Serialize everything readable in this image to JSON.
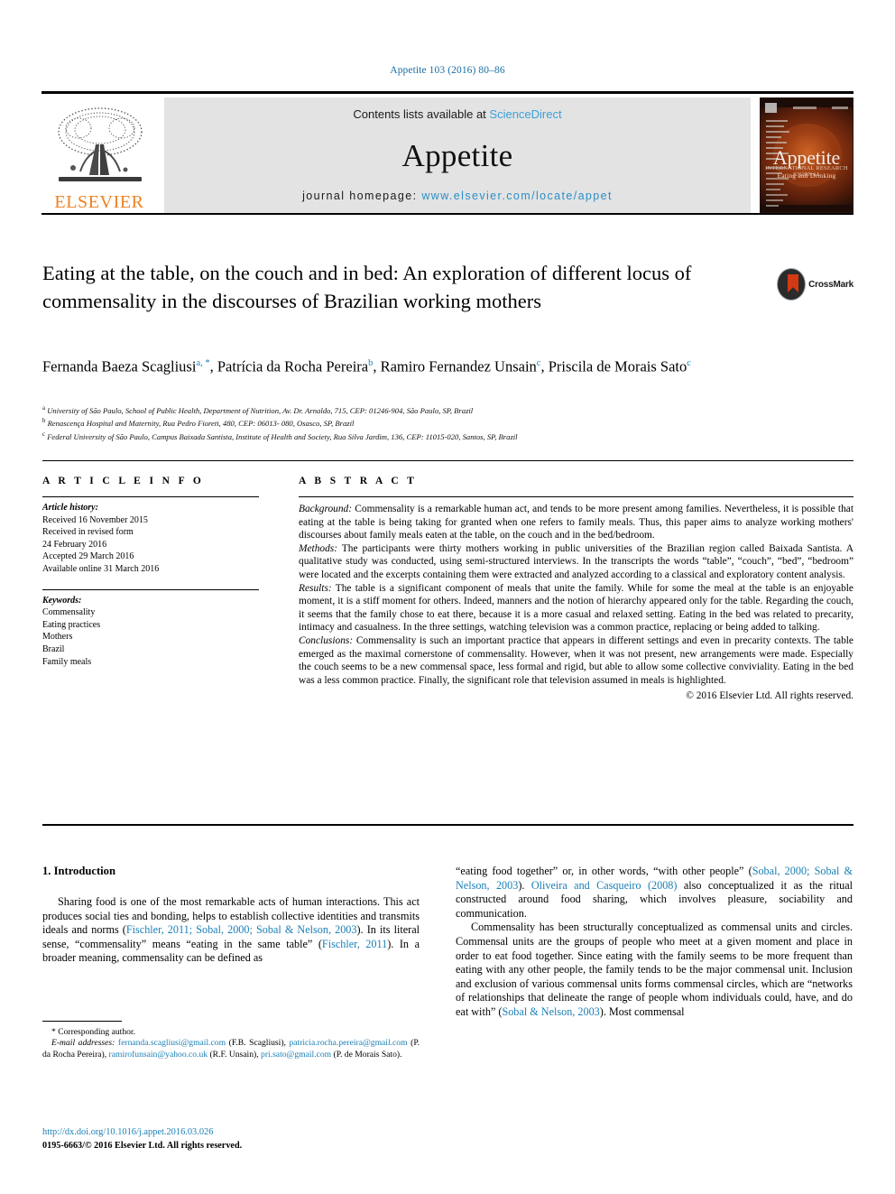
{
  "running_head": "Appetite 103 (2016) 80–86",
  "masthead": {
    "publisher_wordmark": "ELSEVIER",
    "contents_prefix": "Contents lists available at ",
    "contents_link": "ScienceDirect",
    "journal_name": "Appetite",
    "homepage_prefix": "journal homepage: ",
    "homepage_url": "www.elsevier.com/locate/appet",
    "cover_title": "Appetite",
    "cover_subtitle_small": "INTERNATIONAL RESEARCH JOURNAL",
    "cover_subtitle": "Eating and Drinking"
  },
  "crossmark": {
    "label": "CrossMark"
  },
  "article": {
    "title": "Eating at the table, on the couch and in bed: An exploration of different locus of commensality in the discourses of Brazilian working mothers",
    "authors_line_1": "Fernanda Baeza Scagliusi",
    "authors_line_1_sup": "a, *",
    "author_2": "Patrícia da Rocha Pereira",
    "author_2_sup": "b",
    "author_3": "Ramiro Fernandez Unsain",
    "author_3_sup": "c",
    "author_4": "Priscila de Morais Sato",
    "author_4_sup": "c",
    "affiliations": [
      {
        "marker": "a",
        "text": "University of São Paulo, School of Public Health, Department of Nutrition, Av. Dr. Arnaldo, 715, CEP: 01246-904, São Paulo, SP, Brazil"
      },
      {
        "marker": "b",
        "text": "Renascença Hospital and Maternity, Rua Pedro Fioreti, 480, CEP: 06013- 080, Osasco, SP, Brazil"
      },
      {
        "marker": "c",
        "text": "Federal University of São Paulo, Campus Baixada Santista, Institute of Health and Society, Rua Silva Jardim, 136, CEP: 11015-020, Santos, SP, Brazil"
      }
    ]
  },
  "article_info": {
    "heading": "A R T I C L E   I N F O",
    "history_label": "Article history:",
    "history": [
      "Received 16 November 2015",
      "Received in revised form",
      "24 February 2016",
      "Accepted 29 March 2016",
      "Available online 31 March 2016"
    ],
    "keywords_label": "Keywords:",
    "keywords": [
      "Commensality",
      "Eating practices",
      "Mothers",
      "Brazil",
      "Family meals"
    ]
  },
  "abstract": {
    "heading": "A B S T R A C T",
    "sections": [
      {
        "label": "Background:",
        "text": " Commensality is a remarkable human act, and tends to be more present among families. Nevertheless, it is possible that eating at the table is being taking for granted when one refers to family meals. Thus, this paper aims to analyze working mothers' discourses about family meals eaten at the table, on the couch and in the bed/bedroom."
      },
      {
        "label": "Methods:",
        "text": " The participants were thirty mothers working in public universities of the Brazilian region called Baixada Santista. A qualitative study was conducted, using semi-structured interviews. In the transcripts the words “table”, “couch”, “bed”, “bedroom” were located and the excerpts containing them were extracted and analyzed according to a classical and exploratory content analysis."
      },
      {
        "label": "Results:",
        "text": " The table is a significant component of meals that unite the family. While for some the meal at the table is an enjoyable moment, it is a stiff moment for others. Indeed, manners and the notion of hierarchy appeared only for the table. Regarding the couch, it seems that the family chose to eat there, because it is a more casual and relaxed setting. Eating in the bed was related to precarity, intimacy and casualness. In the three settings, watching television was a common practice, replacing or being added to talking."
      },
      {
        "label": "Conclusions:",
        "text": " Commensality is such an important practice that appears in different settings and even in precarity contexts. The table emerged as the maximal cornerstone of commensality. However, when it was not present, new arrangements were made. Especially the couch seems to be a new commensal space, less formal and rigid, but able to allow some collective conviviality. Eating in the bed was a less common practice. Finally, the significant role that television assumed in meals is highlighted."
      }
    ],
    "copyright": "© 2016 Elsevier Ltd. All rights reserved."
  },
  "introduction": {
    "heading": "1. Introduction",
    "left_paragraph_1_a": "Sharing food is one of the most remarkable acts of human interactions. This act produces social ties and bonding, helps to establish collective identities and transmits ideals and norms (",
    "left_cite_1": "Fischler, 2011; Sobal, 2000; Sobal & Nelson, 2003",
    "left_paragraph_1_b": "). In its literal sense, “commensality” means “eating in the same table” (",
    "left_cite_2": "Fischler, 2011",
    "left_paragraph_1_c": "). In a broader meaning, commensality can be defined as",
    "right_paragraph_1_a": "“eating food together” or, in other words, “with other people” (",
    "right_cite_1": "Sobal, 2000; Sobal & Nelson, 2003",
    "right_paragraph_1_b": "). ",
    "right_cite_2": "Oliveira and Casqueiro (2008)",
    "right_paragraph_1_c": " also conceptualized it as the ritual constructed around food sharing, which involves pleasure, sociability and communication.",
    "right_paragraph_2_a": "Commensality has been structurally conceptualized as commensal units and circles. Commensal units are the groups of people who meet at a given moment and place in order to eat food together. Since eating with the family seems to be more frequent than eating with any other people, the family tends to be the major commensal unit. Inclusion and exclusion of various commensal units forms commensal circles, which are “networks of relationships that delineate the range of people whom individuals could, have, and do eat with” (",
    "right_cite_3": "Sobal & Nelson, 2003",
    "right_paragraph_2_b": "). Most commensal"
  },
  "footnote": {
    "corresponding": "* Corresponding author.",
    "email_label": "E-mail addresses:",
    "emails": [
      {
        "address": "fernanda.scagliusi@gmail.com",
        "owner": " (F.B. Scagliusi), "
      },
      {
        "address": "patricia.rocha.pereira@gmail.com",
        "owner": " (P. da Rocha Pereira), "
      },
      {
        "address": "ramirofunsain@yahoo.co.uk",
        "owner": " (R.F. Unsain), "
      },
      {
        "address": "pri.sato@gmail.com",
        "owner": " (P. de Morais Sato)."
      }
    ],
    "doi": "http://dx.doi.org/10.1016/j.appet.2016.03.026",
    "issn": "0195-6663/© 2016 Elsevier Ltd. All rights reserved."
  }
}
